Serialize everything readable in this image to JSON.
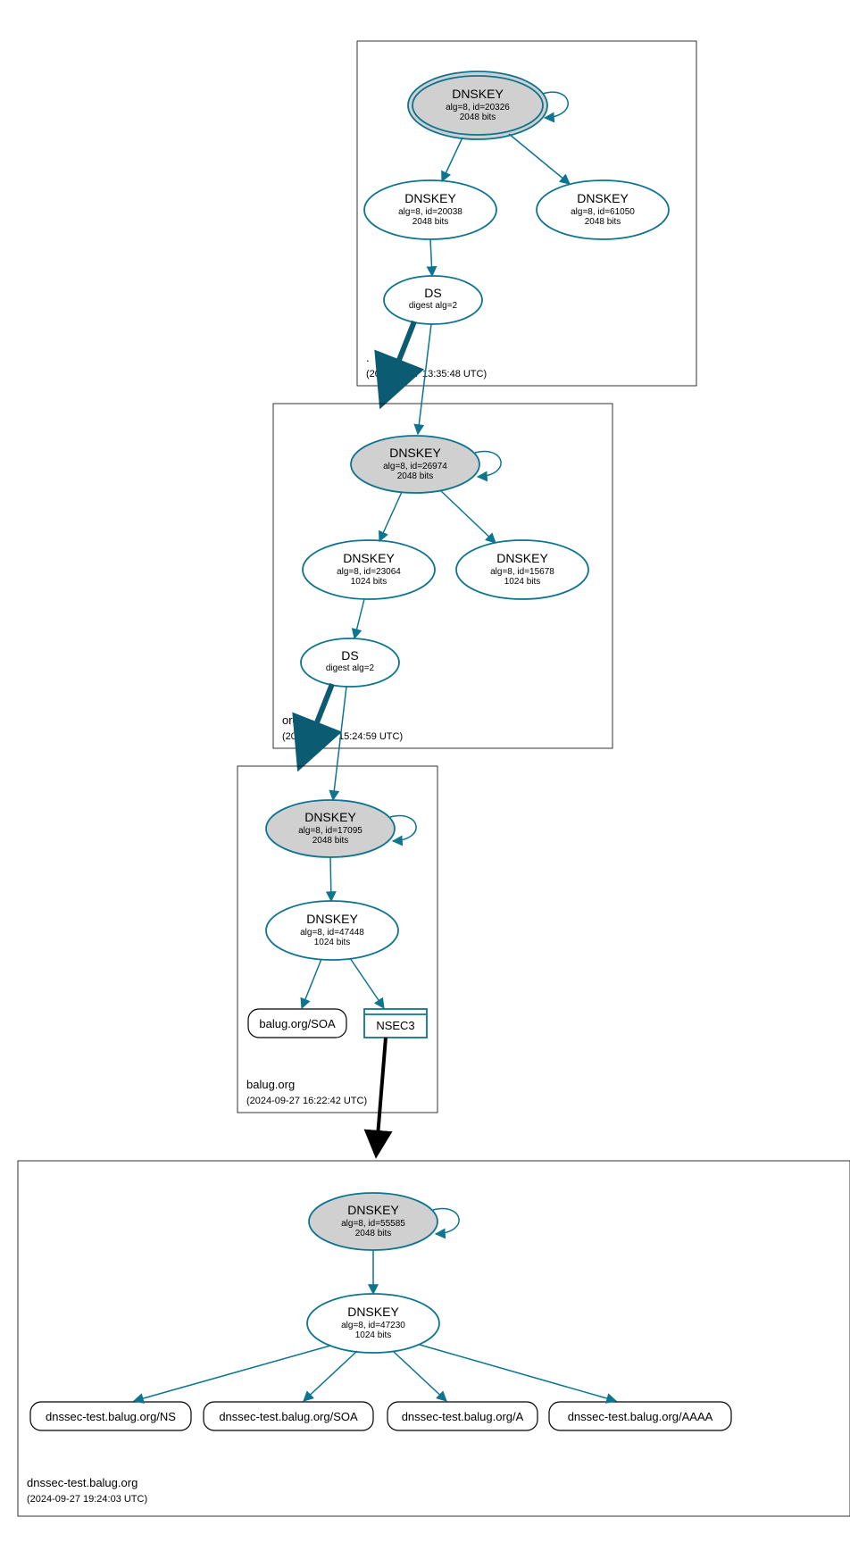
{
  "color": "#0e7490",
  "zones": {
    "root": {
      "name": ".",
      "time": "(2024-09-27 13:35:48 UTC)"
    },
    "org": {
      "name": "org",
      "time": "(2024-09-27 15:24:59 UTC)"
    },
    "balug": {
      "name": "balug.org",
      "time": "(2024-09-27 16:22:42 UTC)"
    },
    "test": {
      "name": "dnssec-test.balug.org",
      "time": "(2024-09-27 19:24:03 UTC)"
    }
  },
  "nodes": {
    "root_ksk": {
      "t": "DNSKEY",
      "s1": "alg=8, id=20326",
      "s2": "2048 bits"
    },
    "root_zsk1": {
      "t": "DNSKEY",
      "s1": "alg=8, id=20038",
      "s2": "2048 bits"
    },
    "root_zsk2": {
      "t": "DNSKEY",
      "s1": "alg=8, id=61050",
      "s2": "2048 bits"
    },
    "root_ds": {
      "t": "DS",
      "s1": "digest alg=2"
    },
    "org_ksk": {
      "t": "DNSKEY",
      "s1": "alg=8, id=26974",
      "s2": "2048 bits"
    },
    "org_zsk1": {
      "t": "DNSKEY",
      "s1": "alg=8, id=23064",
      "s2": "1024 bits"
    },
    "org_zsk2": {
      "t": "DNSKEY",
      "s1": "alg=8, id=15678",
      "s2": "1024 bits"
    },
    "org_ds": {
      "t": "DS",
      "s1": "digest alg=2"
    },
    "balug_ksk": {
      "t": "DNSKEY",
      "s1": "alg=8, id=17095",
      "s2": "2048 bits"
    },
    "balug_zsk": {
      "t": "DNSKEY",
      "s1": "alg=8, id=47448",
      "s2": "1024 bits"
    },
    "balug_soa": "balug.org/SOA",
    "balug_nsec3": "NSEC3",
    "test_ksk": {
      "t": "DNSKEY",
      "s1": "alg=8, id=55585",
      "s2": "2048 bits"
    },
    "test_zsk": {
      "t": "DNSKEY",
      "s1": "alg=8, id=47230",
      "s2": "1024 bits"
    },
    "test_ns": "dnssec-test.balug.org/NS",
    "test_soa": "dnssec-test.balug.org/SOA",
    "test_a": "dnssec-test.balug.org/A",
    "test_aaaa": "dnssec-test.balug.org/AAAA"
  }
}
